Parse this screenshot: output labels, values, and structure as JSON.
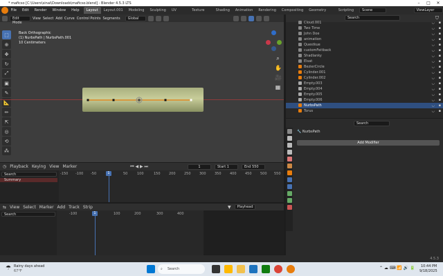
{
  "window": {
    "title": "* maficso [C:\\Users\\sinai\\Downloads\\maficso.blend] - Blender 4.5.3 LTS"
  },
  "topbar": {
    "menus": [
      "File",
      "Edit",
      "Render",
      "Window",
      "Help"
    ],
    "workspaces": [
      "Layout",
      "Layout.001",
      "Modeling",
      "Sculpting",
      "UV Editing",
      "Texture Paint",
      "Shading",
      "Animation",
      "Rendering",
      "Compositing",
      "Geometry Nodes",
      "Scripting"
    ],
    "active_workspace": "Layout",
    "scene": "Scene",
    "view_layer": "ViewLayer"
  },
  "viewport": {
    "mode": "Edit Mode",
    "menus": [
      "View",
      "Select",
      "Add",
      "Curve",
      "Control Points",
      "Segments"
    ],
    "orientation": "Global",
    "info_line1": "Back Orthographic",
    "info_line2": "(1) NurbsPath | NurbsPath.001",
    "info_line3": "10 Centimeters"
  },
  "timeline": {
    "menus": [
      "Playback",
      "Keying",
      "View",
      "Marker"
    ],
    "current_frame": "1",
    "start_label": "Start",
    "start": "1",
    "end_label": "End",
    "end": "550",
    "search_placeholder": "Search",
    "summary": "Summary",
    "ruler": [
      "-150",
      "-100",
      "-50",
      "1",
      "50",
      "100",
      "150",
      "200",
      "250",
      "300",
      "350",
      "400",
      "450",
      "500",
      "550"
    ]
  },
  "nla": {
    "menus": [
      "View",
      "Select",
      "Marker",
      "Add",
      "Track",
      "Strip"
    ],
    "search_placeholder": "Search",
    "playhead": "Playhead",
    "current_frame": "1",
    "ruler": [
      "-100",
      "1",
      "100",
      "200",
      "300",
      "400"
    ]
  },
  "outliner": {
    "search_placeholder": "Search",
    "items": [
      "Cloud.001",
      "Two Time",
      "John Doe",
      "animation",
      "Questkue",
      "customFeitback",
      "Shadlanky",
      "Elsat",
      "BezierCircle",
      "Cylinder.001",
      "Cylinder.002",
      "Empty.003",
      "Empty.004",
      "Empty.005",
      "Empty.006",
      "NurbsPath",
      "Torus"
    ],
    "selected": "NurbsPath"
  },
  "properties": {
    "search_placeholder": "Search",
    "object_name": "NurbsPath",
    "add_modifier": "Add Modifier"
  },
  "statusbar": {
    "version": "4.5.3"
  },
  "taskbar": {
    "weather_title": "Rainy days ahead",
    "weather_temp": "67°F",
    "search_placeholder": "Search",
    "time": "10:44 PM",
    "date": "9/18/2025"
  },
  "colors": {
    "accent": "#4772b3",
    "selection": "#2f4f80",
    "curve": "#e87d0d"
  }
}
